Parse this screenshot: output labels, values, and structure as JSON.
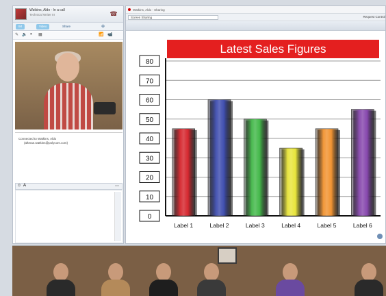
{
  "left_panel": {
    "caller_name": "Watkins, Aldo - In a call",
    "caller_sub": "Technical Writer III",
    "tabs": [
      "IM",
      "Video",
      "Share"
    ],
    "connected_line1": "Connected to Watkins, Aldo",
    "connected_line2": "(aftman.watkins@polycom.com)"
  },
  "right_panel": {
    "title_bar": "Watkins, Aldo - Sharing",
    "dropdown_value": "Screen Sharing",
    "request_label": "Request Control"
  },
  "chart_data": {
    "type": "bar",
    "title": "Latest Sales Figures",
    "categories": [
      "Label 1",
      "Label 2",
      "Label 3",
      "Label 4",
      "Label 5",
      "Label 6"
    ],
    "values": [
      45,
      60,
      50,
      35,
      45,
      55
    ],
    "ylim": [
      0,
      80
    ],
    "yticks": [
      0,
      10,
      20,
      30,
      40,
      50,
      60,
      70,
      80
    ],
    "colors": [
      "#d2141c",
      "#2e3ea8",
      "#33b23a",
      "#e6e229",
      "#f08a1f",
      "#7c37a6"
    ],
    "grid": true
  }
}
